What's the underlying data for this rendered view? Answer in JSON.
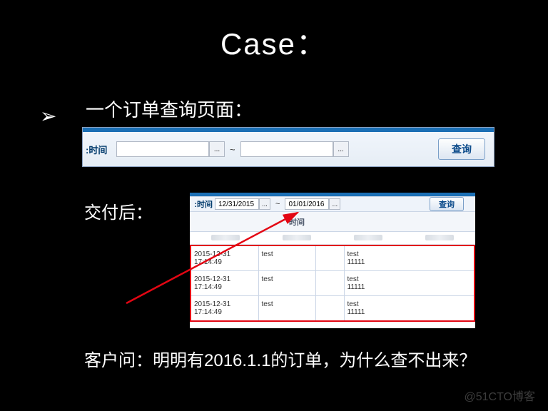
{
  "title": "Case：",
  "line1": "一个订单查询页面：",
  "line2": "交付后：",
  "line3": "客户问：明明有2016.1.1的订单，为什么查不出来？",
  "panel1": {
    "time_label": "时间:",
    "date_from": "",
    "date_to": "",
    "ellipsis": "...",
    "tilde": "~",
    "search": "查询"
  },
  "panel2": {
    "time_label": "时间:",
    "date_from": "12/31/2015",
    "date_to": "01/01/2016",
    "ellipsis": "...",
    "tilde": "~",
    "search": "查询",
    "header_time": "时间",
    "rows": [
      {
        "ts": "2015-12-31 17:14:49",
        "c2": "test",
        "c4a": "test",
        "c4b": "11111"
      },
      {
        "ts": "2015-12-31 17:14:49",
        "c2": "test",
        "c4a": "test",
        "c4b": "11111"
      },
      {
        "ts": "2015-12-31 17:14:49",
        "c2": "test",
        "c4a": "test",
        "c4b": "11111"
      }
    ]
  },
  "watermark": "@51CTO博客"
}
